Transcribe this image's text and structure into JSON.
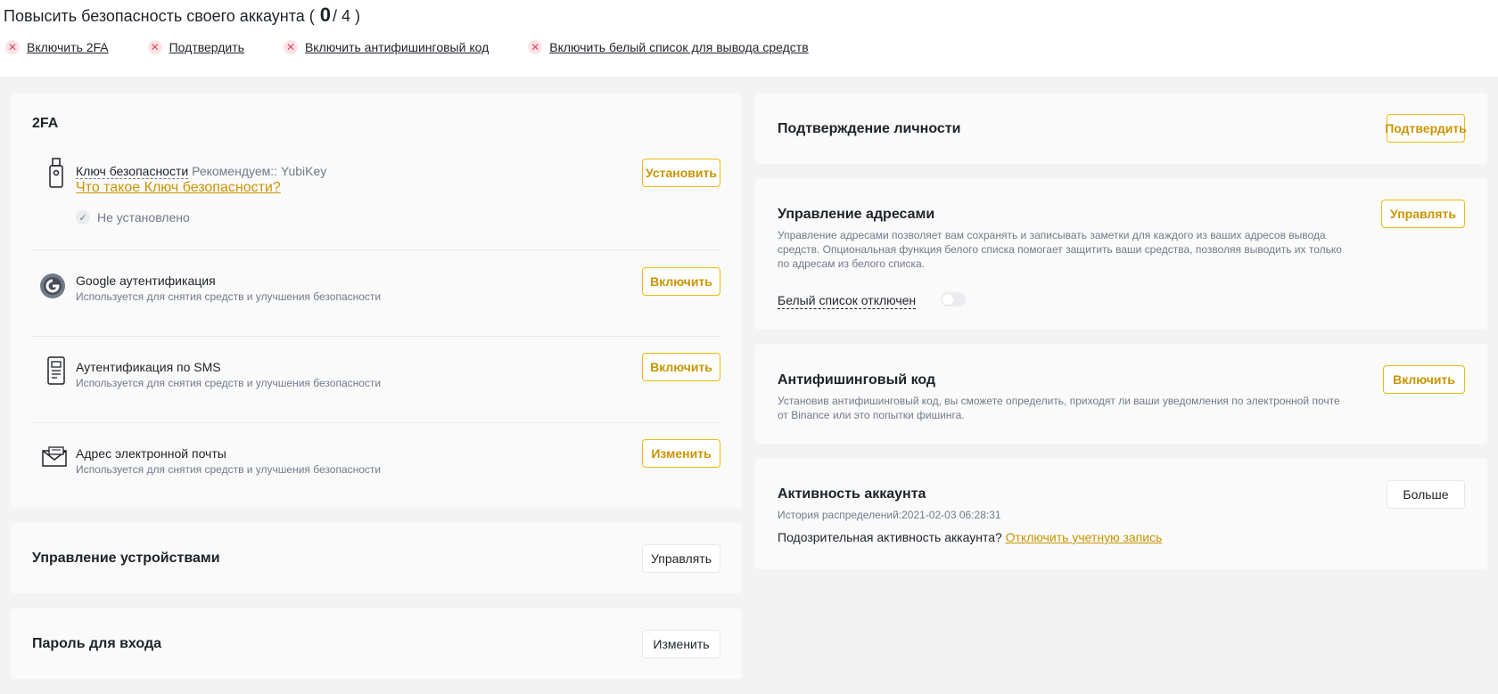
{
  "progress": {
    "title": "Повысить безопасность своего аккаунта (",
    "done": "0",
    "total": "/ 4 )",
    "steps": [
      {
        "label": "Включить 2FA"
      },
      {
        "label": "Подтвердить"
      },
      {
        "label": "Включить антифишинговый код"
      },
      {
        "label": "Включить белый список для вывода средств"
      }
    ]
  },
  "twofa": {
    "title": "2FA",
    "security_key": {
      "name": "Ключ безопасности",
      "recommend": "Рекомендуем:: YubiKey",
      "link": "Что такое Ключ безопасности?",
      "status": "Не установлено",
      "button": "Установить"
    },
    "google": {
      "name": "Google аутентификация",
      "desc": "Используется для снятия средств и улучшения безопасности",
      "button": "Включить"
    },
    "sms": {
      "name": "Аутентификация по SMS",
      "desc": "Используется для снятия средств и улучшения безопасности",
      "button": "Включить"
    },
    "email": {
      "name": "Адрес электронной почты",
      "desc": "Используется для снятия средств и улучшения безопасности",
      "button": "Изменить"
    }
  },
  "devices": {
    "title": "Управление устройствами",
    "button": "Управлять"
  },
  "password": {
    "title": "Пароль для входа",
    "button": "Изменить"
  },
  "identity": {
    "title": "Подтверждение личности",
    "button": "Подтвердить"
  },
  "address": {
    "title": "Управление адресами",
    "desc_lines": [
      "Управление адресами позволяет вам сохранять и записывать заметки для каждого из ваших адресов вывода",
      "средств. Опциональная функция белого списка помогает защитить ваши средства, позволяя выводить их только",
      "по адресам из белого списка."
    ],
    "whitelist_label": "Белый список отключен",
    "whitelist_on": false,
    "button": "Управлять"
  },
  "antiphishing": {
    "title": "Антифишинговый код",
    "desc_lines": [
      "Установив антифишинговый код, вы сможете определить, приходят ли ваши уведомления по электронной почте",
      "от Binance или это попытки фишинга."
    ],
    "button": "Включить"
  },
  "activity": {
    "title": "Активность аккаунта",
    "history": "История распределений:2021-02-03 06:28:31",
    "suspicious": "Подозрительная активность аккаунта?",
    "disable_link": "Отключить учетную запись",
    "button": "Больше"
  },
  "colors": {
    "accent": "#f0b90b",
    "accent_text": "#c99400",
    "error": "#e6455f"
  }
}
